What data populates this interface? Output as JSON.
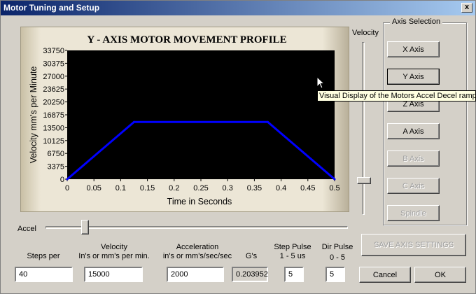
{
  "window": {
    "title": "Motor Tuning and Setup",
    "close_glyph": "x"
  },
  "chart_data": {
    "type": "line",
    "title": "Y - AXIS MOTOR MOVEMENT PROFILE",
    "xlabel": "Time in Seconds",
    "ylabel": "Velocity mm's per Minute",
    "xlim": [
      0,
      0.5
    ],
    "ylim": [
      0,
      33750
    ],
    "x_ticks": [
      "0",
      "0.05",
      "0.1",
      "0.15",
      "0.2",
      "0.25",
      "0.3",
      "0.35",
      "0.4",
      "0.45",
      "0.5"
    ],
    "y_ticks": [
      "0",
      "3375",
      "6750",
      "10125",
      "13500",
      "16875",
      "20250",
      "23625",
      "27000",
      "30375",
      "33750"
    ],
    "grid": false,
    "background": "#000000",
    "series": [
      {
        "color": "#0000ff",
        "x": [
          0,
          0.125,
          0.375,
          0.5
        ],
        "y": [
          0,
          15000,
          15000,
          0
        ]
      }
    ]
  },
  "velocity_label": "Velocity",
  "velocity_slider": {
    "value": 0.2
  },
  "axis_selection": {
    "label": "Axis Selection",
    "buttons": [
      {
        "label": "X Axis",
        "enabled": true
      },
      {
        "label": "Y Axis",
        "enabled": true
      },
      {
        "label": "Z Axis",
        "enabled": true
      },
      {
        "label": "A Axis",
        "enabled": true
      },
      {
        "label": "B Axis",
        "enabled": false
      },
      {
        "label": "C Axis",
        "enabled": false
      },
      {
        "label": "Spindle",
        "enabled": false
      }
    ]
  },
  "tooltip": "Visual Display of the Motors Accel  Decel ramps",
  "accel": {
    "label": "Accel",
    "value": 0.13
  },
  "fields": {
    "steps_per": {
      "label": "Steps per",
      "value": "40"
    },
    "velocity": {
      "label_line1": "Velocity",
      "label_line2": "In's or mm's per min.",
      "value": "15000"
    },
    "acceleration": {
      "label_line1": "Acceleration",
      "label_line2": "in's or mm's/sec/sec",
      "value": "2000"
    },
    "gs": {
      "label": "G's",
      "value": "0.203952"
    },
    "step_pulse": {
      "label_line1": "Step Pulse",
      "label_line2": "1 - 5 us",
      "value": "5"
    },
    "dir_pulse": {
      "label_line1": "Dir Pulse",
      "label_line2": "0 - 5",
      "value": "5"
    }
  },
  "buttons": {
    "save": "SAVE AXIS SETTINGS",
    "cancel": "Cancel",
    "ok": "OK"
  }
}
